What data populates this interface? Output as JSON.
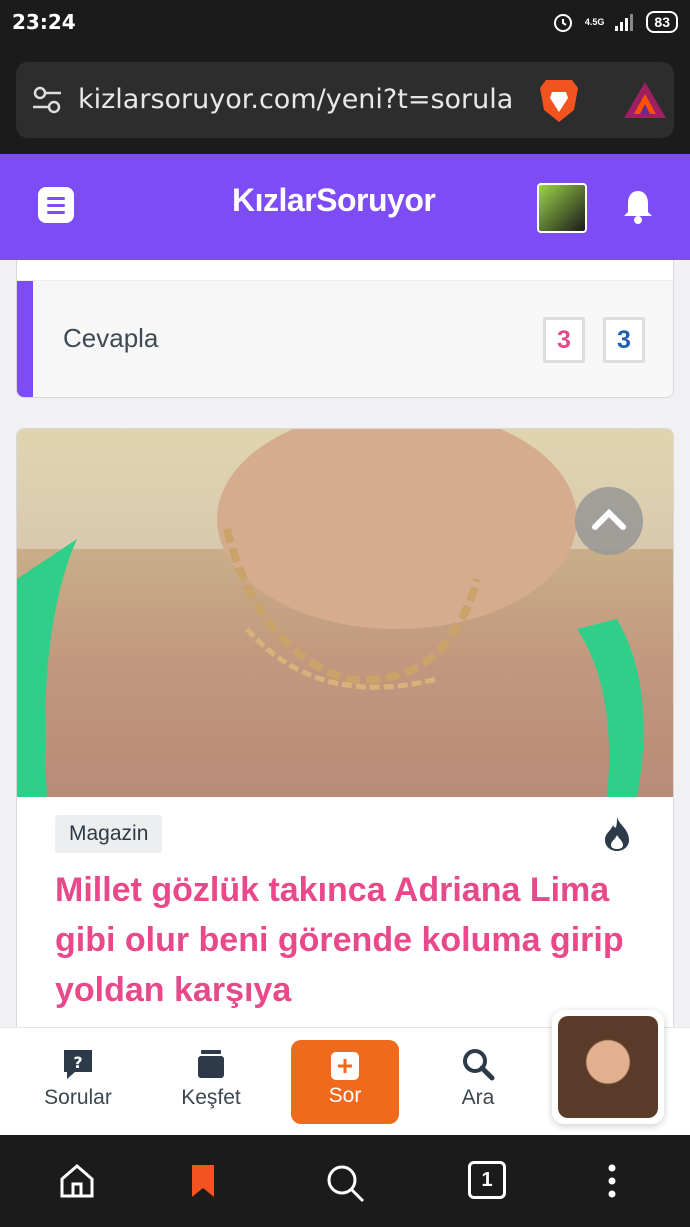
{
  "status": {
    "time": "23:24",
    "network": "4.5G",
    "battery": "83"
  },
  "browser": {
    "url": "kizlarsoruyor.com/yeni?t=sorula"
  },
  "header": {
    "logo_text": "KızlarSoruyor"
  },
  "card1": {
    "answer_label": "Cevapla",
    "count_pink": "3",
    "count_blue": "3"
  },
  "card2": {
    "category": "Magazin",
    "title": "Millet gözlük takınca Adriana Lima gibi olur beni görende koluma girip yoldan karşıya"
  },
  "bottom_nav": {
    "questions": "Sorular",
    "explore": "Keşfet",
    "ask": "Sor",
    "search": "Ara"
  },
  "system_nav": {
    "tab_count": "1"
  },
  "colors": {
    "brand": "#7d4cf5",
    "title_pink": "#e8498a",
    "ask_orange": "#f06a1e",
    "count_blue": "#1e5fb0"
  }
}
